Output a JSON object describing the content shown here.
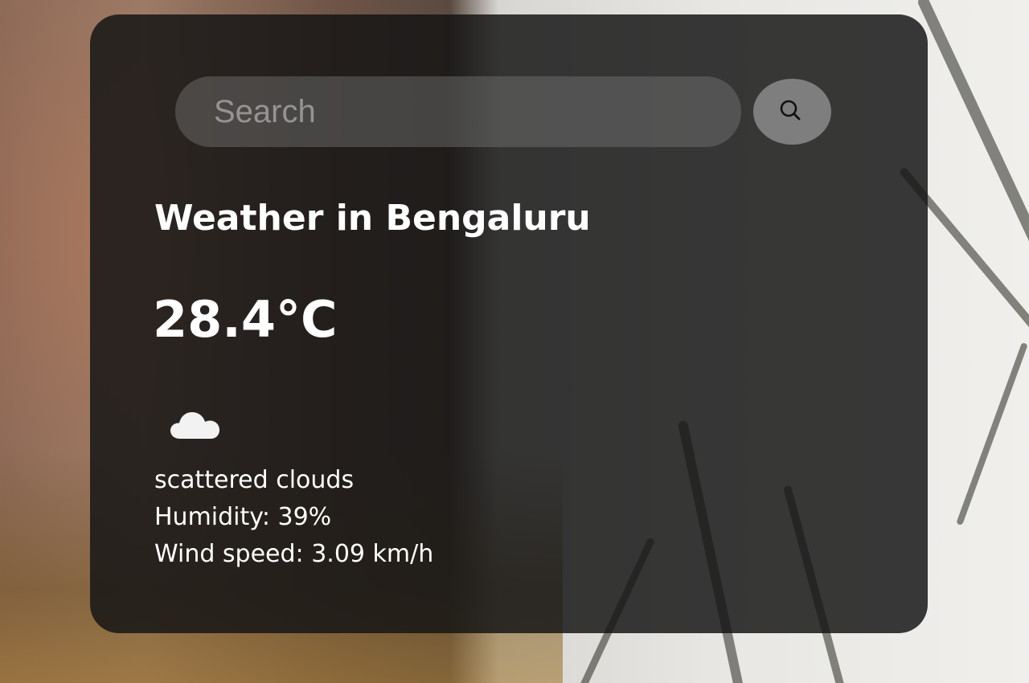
{
  "search": {
    "placeholder": "Search",
    "value": ""
  },
  "weather": {
    "title": "Weather in Bengaluru",
    "temperature": "28.4°C",
    "icon": "cloud-icon",
    "description": "scattered clouds",
    "humidity": "Humidity: 39%",
    "wind": "Wind speed: 3.09 km/h"
  },
  "colors": {
    "card": "#141414",
    "search_button": "#7e7e7e",
    "text": "#ffffff"
  }
}
